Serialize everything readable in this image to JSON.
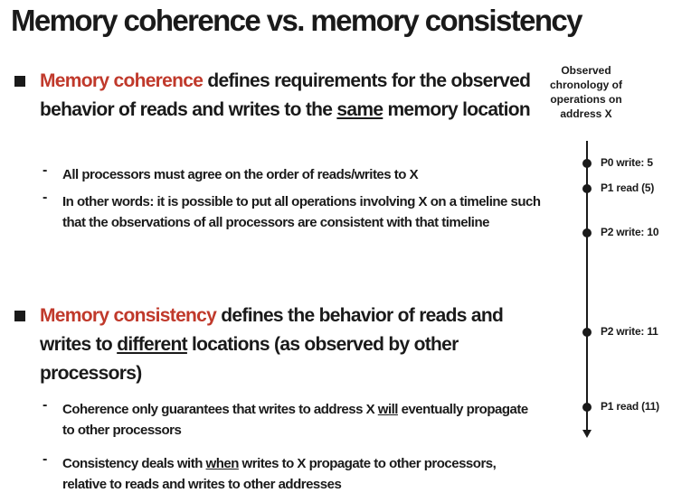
{
  "slide": {
    "title": "Memory coherence vs. memory consistency",
    "point1": {
      "term": "Memory coherence",
      "text_a": " defines requirements for the observed behavior of reads and writes to the ",
      "underlined": "same",
      "text_b": " memory location",
      "sub1": "All processors must agree on the order of reads/writes to X",
      "sub2": "In other words: it is possible to put all operations involving X on a timeline such that the observations of all processors are consistent with that timeline"
    },
    "point2": {
      "term": "Memory consistency",
      "text_a": " defines the behavior of reads and writes to ",
      "underlined": "different",
      "text_b": " locations (as observed by other processors)",
      "sub1_a": "Coherence only guarantees that writes to address X ",
      "sub1_underlined": "will",
      "sub1_b": " eventually propagate to other processors",
      "sub2_a": "Consistency deals with ",
      "sub2_underlined": "when",
      "sub2_b": " writes to X propagate to other processors, relative to reads and writes to other addresses"
    },
    "dash": "-"
  },
  "timeline": {
    "heading": "Observed chronology of operations on address X",
    "events": [
      {
        "label": "P0 write: 5"
      },
      {
        "label": "P1 read (5)"
      },
      {
        "label": "P2 write: 10"
      },
      {
        "label": "P2 write: 11"
      },
      {
        "label": "P1 read (11)"
      }
    ]
  },
  "colors": {
    "accent": "#c0392b",
    "text": "#1a1a1a"
  }
}
